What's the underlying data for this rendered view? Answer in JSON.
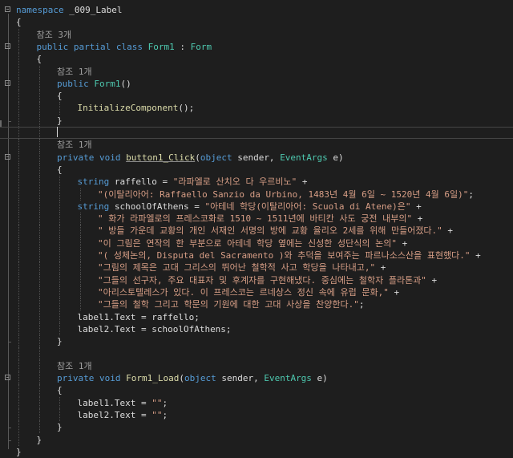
{
  "colors": {
    "background": "#1e1e1e",
    "keyword": "#569cd6",
    "type": "#4ec9b0",
    "string": "#d69d85",
    "method": "#dcdcaa",
    "plain": "#dcdcdc",
    "reference": "#a0a0a0"
  },
  "editor": {
    "current_line": 10,
    "lines": [
      {
        "indent": 0,
        "fold": true,
        "tokens": [
          [
            "kw",
            "namespace"
          ],
          [
            "nm",
            " _009_Label"
          ]
        ]
      },
      {
        "indent": 0,
        "tokens": [
          [
            "nm",
            "{"
          ]
        ]
      },
      {
        "indent": 1,
        "tokens": [
          [
            "ref",
            "참조 3개"
          ]
        ]
      },
      {
        "indent": 1,
        "fold": true,
        "tokens": [
          [
            "kw",
            "public"
          ],
          [
            "nm",
            " "
          ],
          [
            "kw",
            "partial"
          ],
          [
            "nm",
            " "
          ],
          [
            "kw",
            "class"
          ],
          [
            "nm",
            " "
          ],
          [
            "ty",
            "Form1"
          ],
          [
            "nm",
            " : "
          ],
          [
            "ty",
            "Form"
          ]
        ]
      },
      {
        "indent": 1,
        "tokens": [
          [
            "nm",
            "{"
          ]
        ]
      },
      {
        "indent": 2,
        "tokens": [
          [
            "ref",
            "참조 1개"
          ]
        ]
      },
      {
        "indent": 2,
        "fold": true,
        "tokens": [
          [
            "kw",
            "public"
          ],
          [
            "nm",
            " "
          ],
          [
            "ty",
            "Form1"
          ],
          [
            "nm",
            "()"
          ]
        ]
      },
      {
        "indent": 2,
        "tokens": [
          [
            "nm",
            "{"
          ]
        ]
      },
      {
        "indent": 3,
        "tokens": [
          [
            "mth",
            "InitializeComponent"
          ],
          [
            "nm",
            "();"
          ]
        ]
      },
      {
        "indent": 2,
        "tokens": [
          [
            "nm",
            "}"
          ]
        ]
      },
      {
        "indent": 2,
        "caret": true,
        "tokens": []
      },
      {
        "indent": 2,
        "tokens": [
          [
            "ref",
            "참조 1개"
          ]
        ]
      },
      {
        "indent": 2,
        "fold": true,
        "tokens": [
          [
            "kw",
            "private"
          ],
          [
            "nm",
            " "
          ],
          [
            "kw",
            "void"
          ],
          [
            "nm",
            " "
          ],
          [
            "mth und",
            "button1_Click"
          ],
          [
            "nm",
            "("
          ],
          [
            "kw",
            "object"
          ],
          [
            "nm",
            " sender, "
          ],
          [
            "ty",
            "EventArgs"
          ],
          [
            "nm",
            " e)"
          ]
        ]
      },
      {
        "indent": 2,
        "tokens": [
          [
            "nm",
            "{"
          ]
        ]
      },
      {
        "indent": 3,
        "tokens": [
          [
            "kw",
            "string"
          ],
          [
            "nm",
            " raffello = "
          ],
          [
            "str",
            "\"라파엘로 산치오 다 우르비노\""
          ],
          [
            "nm",
            " +"
          ]
        ]
      },
      {
        "indent": 4,
        "tokens": [
          [
            "str",
            "\"(이탈리아어: Raffaello Sanzio da Urbino, 1483년 4월 6일 ~ 1520년 4월 6일)\""
          ],
          [
            "nm",
            ";"
          ]
        ]
      },
      {
        "indent": 3,
        "tokens": [
          [
            "kw",
            "string"
          ],
          [
            "nm",
            " schoolOfAthens = "
          ],
          [
            "str",
            "\"아테네 학당(이탈리아어: Scuola di Atene)은\""
          ],
          [
            "nm",
            " +"
          ]
        ]
      },
      {
        "indent": 4,
        "tokens": [
          [
            "str",
            "\" 화가 라파엘로의 프레스코화로 1510 ~ 1511년에 바티칸 사도 궁전 내부의\""
          ],
          [
            "nm",
            " +"
          ]
        ]
      },
      {
        "indent": 4,
        "tokens": [
          [
            "str",
            "\" 방들 가운데 교황의 개인 서재인 서명의 방에 교황 율리오 2세를 위해 만들어졌다.\""
          ],
          [
            "nm",
            " +"
          ]
        ]
      },
      {
        "indent": 4,
        "tokens": [
          [
            "str",
            "\"이 그림은 연작의 한 부분으로 아테네 학당 옆에는 신성한 성단식의 논의\""
          ],
          [
            "nm",
            " +"
          ]
        ]
      },
      {
        "indent": 4,
        "tokens": [
          [
            "str",
            "\"( 성체논의, Disputa del Sacramento )와 추덕을 보여주는 파르나소스산을 표현했다.\""
          ],
          [
            "nm",
            " +"
          ]
        ]
      },
      {
        "indent": 4,
        "tokens": [
          [
            "str",
            "\"그림의 제목은 고대 그리스의 뛰어난 철학적 사고 학당을 나타내고,\""
          ],
          [
            "nm",
            " +"
          ]
        ]
      },
      {
        "indent": 4,
        "tokens": [
          [
            "str",
            "\"그들의 선구자, 주요 대표자 및 후계자를 구현해냈다. 중심에는 철학자 플라톤과\""
          ],
          [
            "nm",
            " +"
          ]
        ]
      },
      {
        "indent": 4,
        "tokens": [
          [
            "str",
            "\"아리스토텔레스가 있다. 이 프레스코는 르네상스 정신 속에 유럽 문화,\""
          ],
          [
            "nm",
            " +"
          ]
        ]
      },
      {
        "indent": 4,
        "tokens": [
          [
            "str",
            "\"그들의 철학 그리고 학문의 기원에 대한 고대 사상을 찬양한다.\""
          ],
          [
            "nm",
            ";"
          ]
        ]
      },
      {
        "indent": 3,
        "tokens": [
          [
            "nm",
            "label1.Text = raffello;"
          ]
        ]
      },
      {
        "indent": 3,
        "tokens": [
          [
            "nm",
            "label2.Text = schoolOfAthens;"
          ]
        ]
      },
      {
        "indent": 2,
        "tokens": [
          [
            "nm",
            "}"
          ]
        ]
      },
      {
        "indent": 2,
        "tokens": []
      },
      {
        "indent": 2,
        "tokens": [
          [
            "ref",
            "참조 1개"
          ]
        ]
      },
      {
        "indent": 2,
        "fold": true,
        "tokens": [
          [
            "kw",
            "private"
          ],
          [
            "nm",
            " "
          ],
          [
            "kw",
            "void"
          ],
          [
            "nm",
            " "
          ],
          [
            "mth",
            "Form1_Load"
          ],
          [
            "nm",
            "("
          ],
          [
            "kw",
            "object"
          ],
          [
            "nm",
            " sender, "
          ],
          [
            "ty",
            "EventArgs"
          ],
          [
            "nm",
            " e)"
          ]
        ]
      },
      {
        "indent": 2,
        "tokens": [
          [
            "nm",
            "{"
          ]
        ]
      },
      {
        "indent": 3,
        "tokens": [
          [
            "nm",
            "label1.Text = "
          ],
          [
            "str",
            "\"\""
          ],
          [
            "nm",
            ";"
          ]
        ]
      },
      {
        "indent": 3,
        "tokens": [
          [
            "nm",
            "label2.Text = "
          ],
          [
            "str",
            "\"\""
          ],
          [
            "nm",
            ";"
          ]
        ]
      },
      {
        "indent": 2,
        "tokens": [
          [
            "nm",
            "}"
          ]
        ]
      },
      {
        "indent": 1,
        "tokens": [
          [
            "nm",
            "}"
          ]
        ]
      },
      {
        "indent": 0,
        "tokens": [
          [
            "nm",
            "}"
          ]
        ]
      }
    ]
  }
}
